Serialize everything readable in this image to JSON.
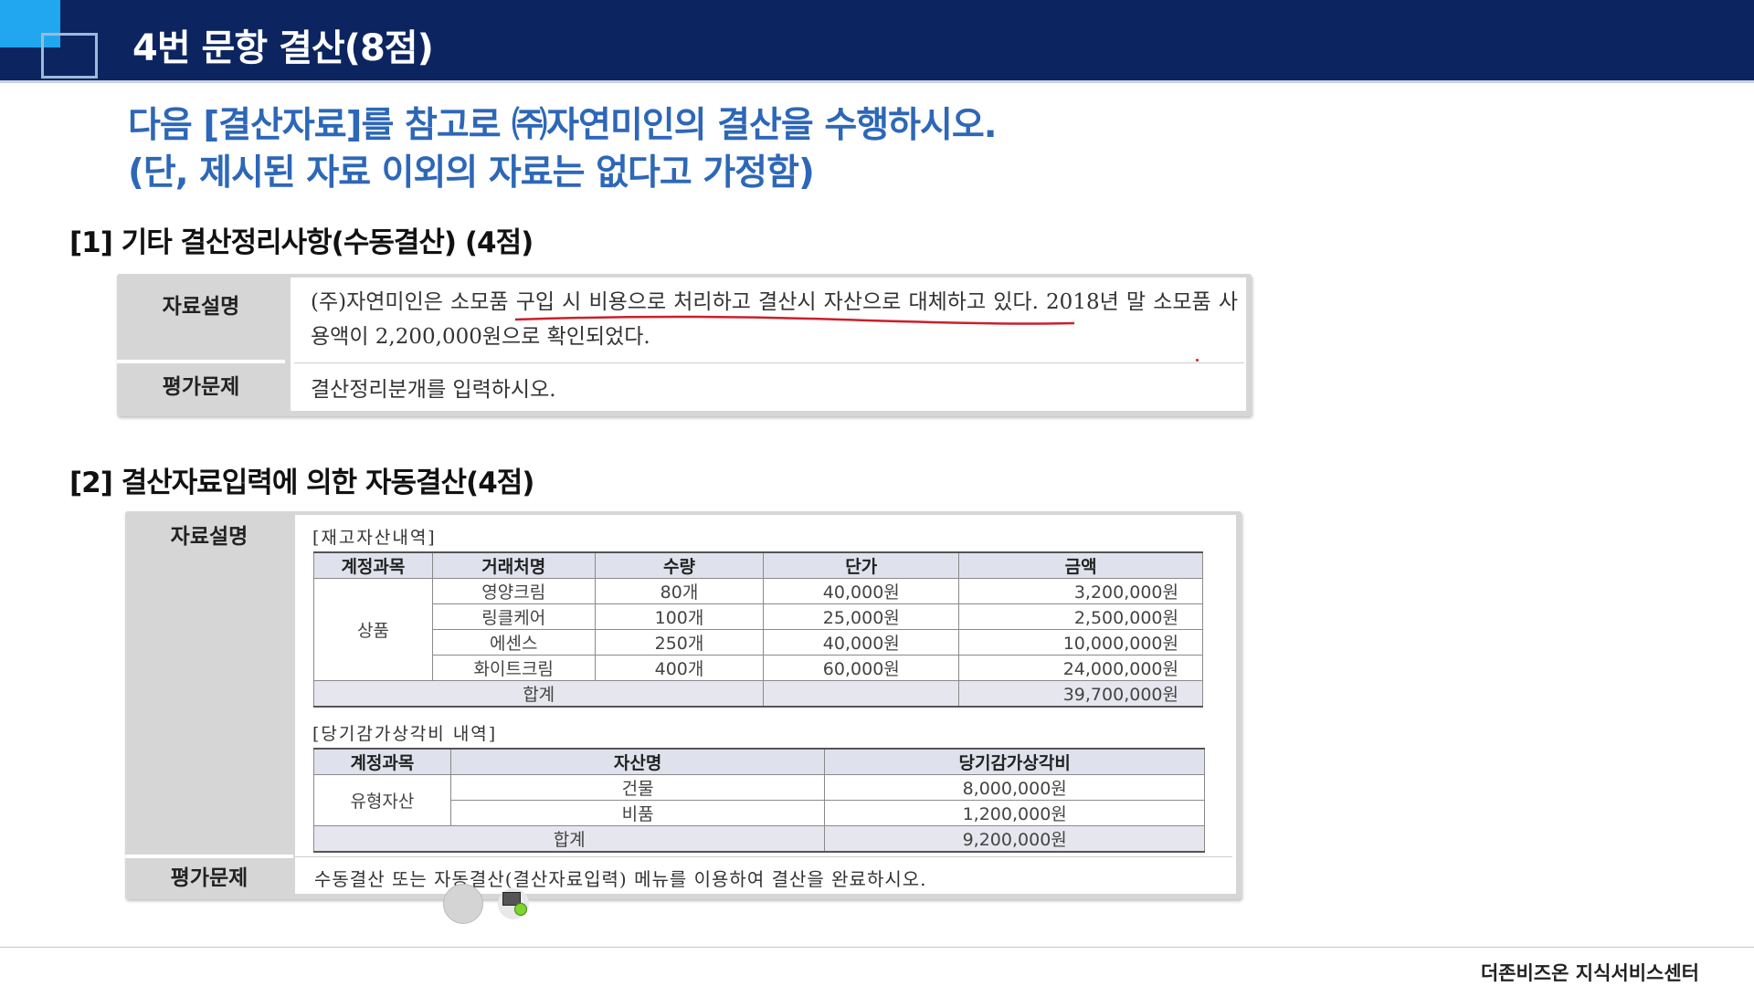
{
  "header": {
    "title": "4번 문항 결산(8점)"
  },
  "intro": {
    "line1": "다음 [결산자료]를 참고로 ㈜자연미인의 결산을 수행하시오.",
    "line2": "(단, 제시된 자료 이외의 자료는 없다고 가정함)"
  },
  "section1": {
    "title": "[1] 기타 결산정리사항(수동결산) (4점)",
    "desc_label": "자료설명",
    "desc_text": "(주)자연미인은 소모품 구입 시 비용으로 처리하고 결산시 자산으로 대체하고 있다. 2018년 말 소모품 사용액이 2,200,000원으로 확인되었다.",
    "question_label": "평가문제",
    "question_text": "결산정리분개를 입력하시오."
  },
  "section2": {
    "title": "[2] 결산자료입력에 의한 자동결산(4점)",
    "desc_label": "자료설명",
    "inventory": {
      "caption": "[재고자산내역]",
      "headers": [
        "계정과목",
        "거래처명",
        "수량",
        "단가",
        "금액"
      ],
      "account": "상품",
      "rows": [
        {
          "name": "영양크림",
          "qty": "80개",
          "price": "40,000원",
          "amount": "3,200,000원"
        },
        {
          "name": "링클케어",
          "qty": "100개",
          "price": "25,000원",
          "amount": "2,500,000원"
        },
        {
          "name": "에센스",
          "qty": "250개",
          "price": "40,000원",
          "amount": "10,000,000원"
        },
        {
          "name": "화이트크림",
          "qty": "400개",
          "price": "60,000원",
          "amount": "24,000,000원"
        }
      ],
      "total_label": "합계",
      "total_amount": "39,700,000원"
    },
    "depreciation": {
      "caption": "[당기감가상각비 내역]",
      "headers": [
        "계정과목",
        "자산명",
        "당기감가상각비"
      ],
      "account": "유형자산",
      "rows": [
        {
          "name": "건물",
          "amount": "8,000,000원"
        },
        {
          "name": "비품",
          "amount": "1,200,000원"
        }
      ],
      "total_label": "합계",
      "total_amount": "9,200,000원"
    },
    "question_label": "평가문제",
    "question_text": "수동결산 또는 자동결산(결산자료입력) 메뉴를 이용하여 결산을 완료하시오."
  },
  "footer": {
    "text": "더존비즈온 지식서비스센터"
  },
  "colors": {
    "header_bg": "#0c2561",
    "accent_blue": "#2d67b8",
    "annotation_red": "#cc1f2b"
  }
}
